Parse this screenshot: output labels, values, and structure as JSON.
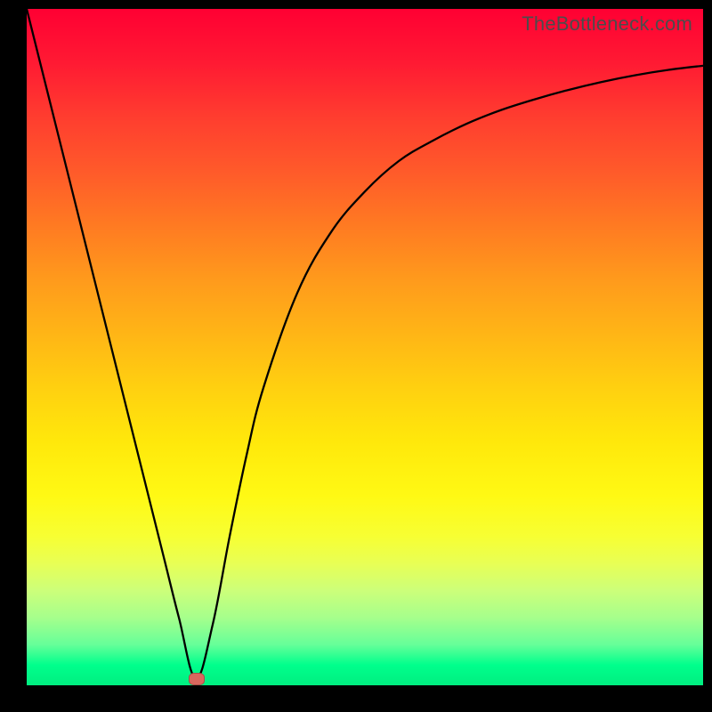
{
  "attribution": "TheBottleneck.com",
  "chart_data": {
    "type": "line",
    "title": "",
    "xlabel": "",
    "ylabel": "",
    "xlim": [
      0,
      100
    ],
    "ylim": [
      0,
      100
    ],
    "grid": false,
    "legend": false,
    "series": [
      {
        "name": "bottleneck-curve",
        "x": [
          0,
          5,
          10,
          15,
          20,
          22.5,
          25,
          27.5,
          30,
          32.5,
          35,
          40,
          45,
          50,
          55,
          60,
          65,
          70,
          75,
          80,
          85,
          90,
          95,
          100
        ],
        "values": [
          100,
          80,
          60,
          40,
          20,
          10,
          1,
          9,
          22,
          34,
          44,
          58,
          67,
          73,
          77.5,
          80.5,
          83,
          85,
          86.6,
          88,
          89.2,
          90.2,
          91,
          91.6
        ]
      }
    ],
    "annotations": [
      {
        "name": "minimum-marker",
        "x": 25,
        "y": 1
      }
    ],
    "background_gradient": {
      "direction": "top-to-bottom",
      "stops": [
        {
          "pos": 0,
          "color": "#ff0033"
        },
        {
          "pos": 50,
          "color": "#ffb516"
        },
        {
          "pos": 75,
          "color": "#fff914"
        },
        {
          "pos": 100,
          "color": "#00ee80"
        }
      ]
    }
  }
}
